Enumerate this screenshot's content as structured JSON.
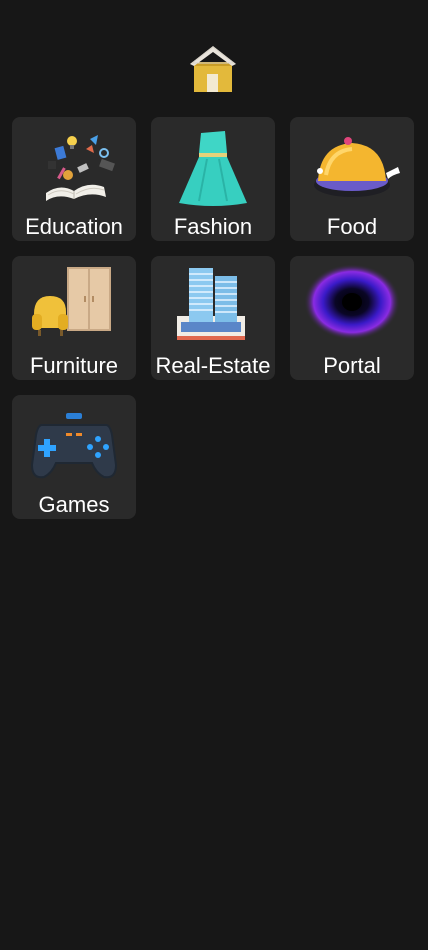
{
  "header": {
    "icon": "home-icon"
  },
  "categories": [
    {
      "label": "Education",
      "icon": "education-icon"
    },
    {
      "label": "Fashion",
      "icon": "fashion-icon"
    },
    {
      "label": "Food",
      "icon": "food-icon"
    },
    {
      "label": "Furniture",
      "icon": "furniture-icon"
    },
    {
      "label": "Real-Estate",
      "icon": "real-estate-icon"
    },
    {
      "label": "Portal",
      "icon": "portal-icon"
    },
    {
      "label": "Games",
      "icon": "games-icon"
    }
  ],
  "colors": {
    "background": "#171717",
    "tile": "#2a2a2a",
    "text": "#ffffff",
    "home_wall": "#e3b93b",
    "home_roof": "#e9e4dc"
  }
}
